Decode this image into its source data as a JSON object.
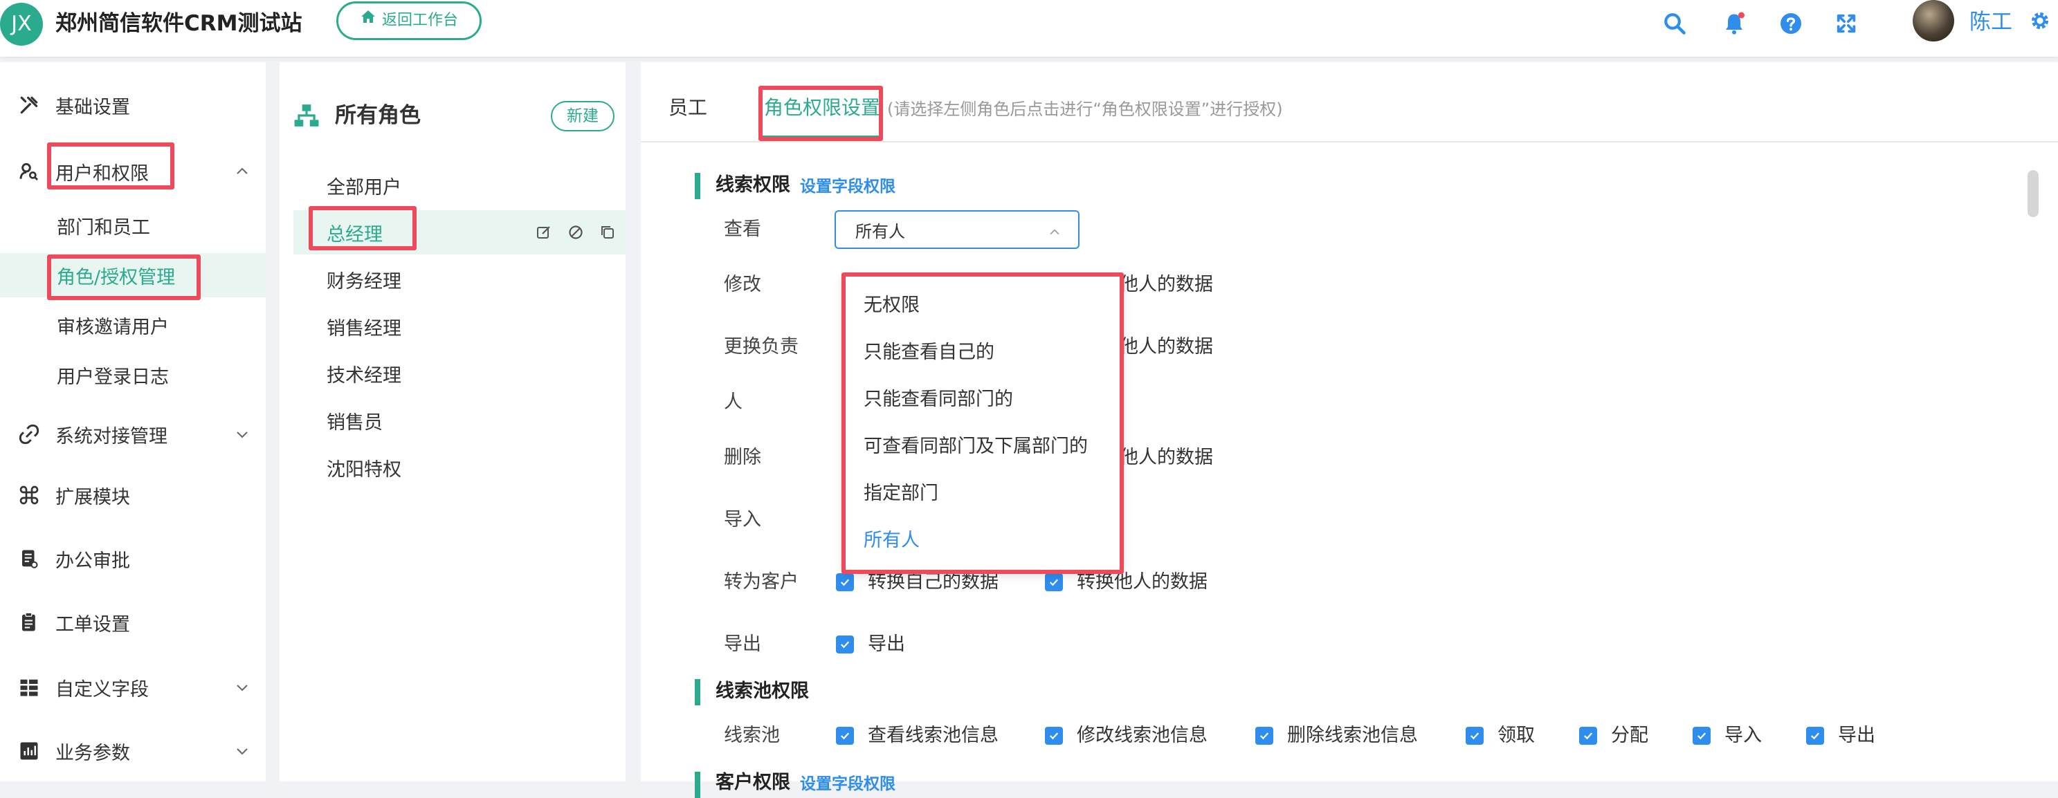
{
  "header": {
    "logo_text": "JX",
    "app_title": "郑州简信软件CRM测试站",
    "back_button": "返回工作台",
    "user_name": "陈工"
  },
  "colors": {
    "brand": "#2bab8e",
    "accent": "#2e8ded",
    "highlight": "#ef4a5b"
  },
  "sidebar": {
    "items": [
      {
        "label": "基础设置",
        "icon": "wrench-icon"
      },
      {
        "label": "用户和权限",
        "icon": "user-key-icon",
        "expanded": true
      },
      {
        "label": "系统对接管理",
        "icon": "link-icon"
      },
      {
        "label": "扩展模块",
        "icon": "command-icon"
      },
      {
        "label": "办公审批",
        "icon": "document-icon"
      },
      {
        "label": "工单设置",
        "icon": "clipboard-icon"
      },
      {
        "label": "自定义字段",
        "icon": "grid-icon"
      },
      {
        "label": "业务参数",
        "icon": "chart-icon"
      }
    ],
    "sub_items": [
      "部门和员工",
      "角色/授权管理",
      "审核邀请用户",
      "用户登录日志"
    ]
  },
  "roles": {
    "title": "所有角色",
    "new_button": "新建",
    "list": [
      "全部用户",
      "总经理",
      "财务经理",
      "销售经理",
      "技术经理",
      "销售员",
      "沈阳特权"
    ]
  },
  "main": {
    "tabs": [
      "员工",
      "角色权限设置"
    ],
    "hint": "(请选择左侧角色后点击进行“角色权限设置”进行授权)",
    "lead": {
      "title": "线索权限",
      "field_link": "设置字段权限",
      "view_label": "查看",
      "view_value": "所有人",
      "edit_label": "修改",
      "owner_label_1": "更换负责",
      "owner_label_2": "人",
      "delete_label": "删除",
      "import_label": "导入",
      "convert_label": "转为客户",
      "export_label": "导出",
      "others_data_partial": "他人的数据",
      "convert_own": "转换自己的数据",
      "convert_others": "转换他人的数据",
      "export_option": "导出"
    },
    "dropdown_options": [
      "无权限",
      "只能查看自己的",
      "只能查看同部门的",
      "可查看同部门及下属部门的",
      "指定部门",
      "所有人"
    ],
    "pool": {
      "title": "线索池权限",
      "row_label": "线索池",
      "options": [
        "查看线索池信息",
        "修改线索池信息",
        "删除线索池信息",
        "领取",
        "分配",
        "导入",
        "导出"
      ]
    },
    "customer": {
      "title": "客户权限",
      "field_link": "设置字段权限"
    }
  }
}
